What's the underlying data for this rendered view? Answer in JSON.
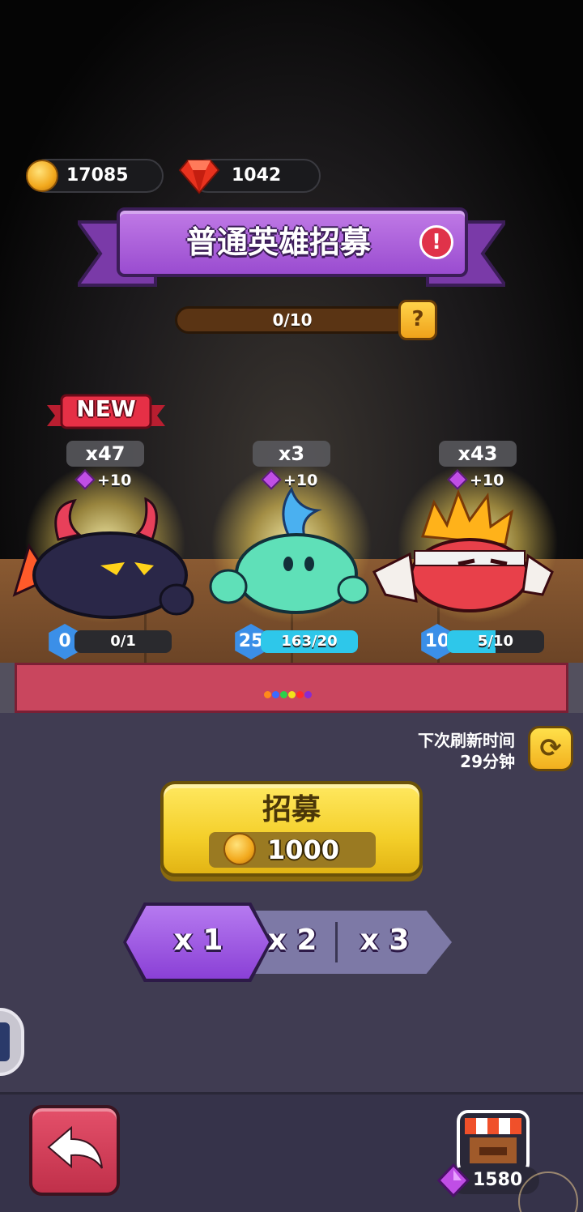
{
  "currency": {
    "coins": "17085",
    "gems": "1042"
  },
  "banner": {
    "title": "普通英雄招募"
  },
  "progress": {
    "text": "0/10",
    "fraction": 0.0
  },
  "heroes": [
    {
      "badge": "NEW",
      "count": "x47",
      "bonus": "+10",
      "level": "0",
      "shards": "0/1",
      "shard_fraction": 0.0
    },
    {
      "count": "x3",
      "bonus": "+10",
      "level": "25",
      "shards": "163/20",
      "shard_fraction": 1.0
    },
    {
      "count": "x43",
      "bonus": "+10",
      "level": "10",
      "shards": "5/10",
      "shard_fraction": 0.5
    }
  ],
  "refresh": {
    "label": "下次刷新时间",
    "time": "29分钟"
  },
  "recruit": {
    "label": "招募",
    "cost": "1000"
  },
  "multiplier": {
    "options": [
      "x 1",
      "x 2",
      "x 3"
    ],
    "selected": "x 1"
  },
  "shop": {
    "gems": "1580"
  },
  "colors": {
    "accent_purple": "#9a4cd0",
    "button_yellow": "#f4cf2a",
    "back_red": "#c9465e",
    "shard_cyan": "#2ec7ea"
  },
  "icons": {
    "coin": "coin-icon",
    "gem": "red-gem-icon",
    "alert": "exclamation-icon",
    "help": "question-icon",
    "refresh": "refresh-icon",
    "back": "back-arrow-icon",
    "shop": "shop-stall-icon"
  }
}
